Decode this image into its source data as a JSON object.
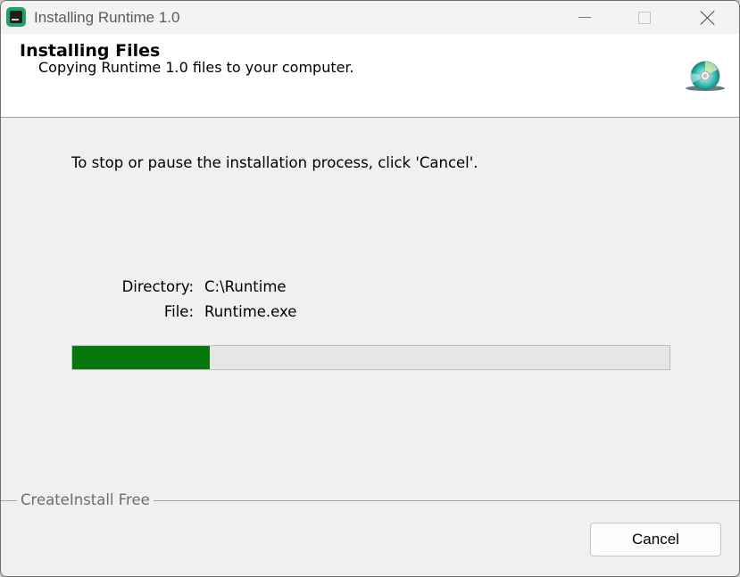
{
  "window": {
    "title": "Installing Runtime 1.0",
    "icons": {
      "app": "app-icon",
      "minimize": "minimize-icon",
      "maximize": "maximize-icon",
      "close": "close-icon"
    }
  },
  "header": {
    "title": "Installing Files",
    "subtitle": "Copying Runtime 1.0 files to your computer.",
    "icon": "cd-disc-icon"
  },
  "body": {
    "instruction": "To stop or pause the installation process, click 'Cancel'.",
    "directory_label": "Directory:",
    "directory_value": "C:\\Runtime",
    "file_label": "File:",
    "file_value": "Runtime.exe",
    "progress_fraction": 0.23
  },
  "footer": {
    "brand": "CreateInstall Free",
    "cancel_label": "Cancel"
  },
  "colors": {
    "progress_fill": "#06780d",
    "progress_track": "#e6e6e6",
    "app_icon_accent": "#21a366",
    "disc_accent": "#2bb3a8"
  }
}
